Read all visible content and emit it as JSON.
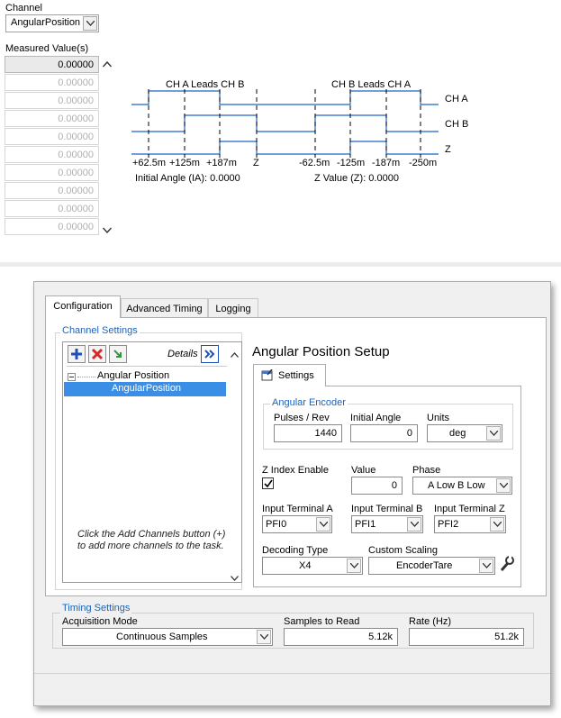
{
  "front_panel": {
    "channel_label": "Channel",
    "channel_value": "AngularPosition",
    "measured_label": "Measured Value(s)",
    "measured_values": [
      "0.00000",
      "0.00000",
      "0.00000",
      "0.00000",
      "0.00000",
      "0.00000",
      "0.00000",
      "0.00000",
      "0.00000",
      "0.00000"
    ],
    "diagram": {
      "ch_a_leads": "CH A Leads CH B",
      "ch_b_leads": "CH B Leads CH A",
      "ch_a": "CH A",
      "ch_b": "CH B",
      "z": "Z",
      "ticks": [
        "+62.5m",
        "+125m",
        "+187m",
        "Z",
        "-62.5m",
        "-125m",
        "-187m",
        "-250m"
      ],
      "initial_angle": "Initial Angle (IA): 0.0000",
      "z_value": "Z Value (Z): 0.0000"
    }
  },
  "dialog": {
    "tabs": [
      "Configuration",
      "Advanced Timing",
      "Logging"
    ],
    "channel_settings": {
      "title": "Channel Settings",
      "details_label": "Details",
      "tree_parent": "Angular Position",
      "tree_child": "AngularPosition",
      "hint": "Click the Add Channels button (+) to add more channels to the task."
    },
    "setup": {
      "title": "Angular Position Setup",
      "settings_tab": "Settings",
      "encoder_group": "Angular Encoder",
      "pulses_label": "Pulses / Rev",
      "pulses_value": "1440",
      "initial_angle_label": "Initial Angle",
      "initial_angle_value": "0",
      "units_label": "Units",
      "units_value": "deg",
      "z_index_label": "Z Index Enable",
      "z_index_checked": true,
      "value_label": "Value",
      "value_value": "0",
      "phase_label": "Phase",
      "phase_value": "A Low B Low",
      "term_a_label": "Input Terminal A",
      "term_a_value": "PFI0",
      "term_b_label": "Input Terminal B",
      "term_b_value": "PFI1",
      "term_z_label": "Input Terminal Z",
      "term_z_value": "PFI2",
      "decoding_label": "Decoding Type",
      "decoding_value": "X4",
      "scaling_label": "Custom Scaling",
      "scaling_value": "EncoderTare"
    },
    "timing": {
      "title": "Timing Settings",
      "acq_label": "Acquisition Mode",
      "acq_value": "Continuous Samples",
      "samples_label": "Samples to Read",
      "samples_value": "5.12k",
      "rate_label": "Rate (Hz)",
      "rate_value": "51.2k"
    }
  },
  "colors": {
    "accent_blue": "#1e63b8",
    "selection": "#3a8ee6",
    "signal": "#1f63c6"
  }
}
